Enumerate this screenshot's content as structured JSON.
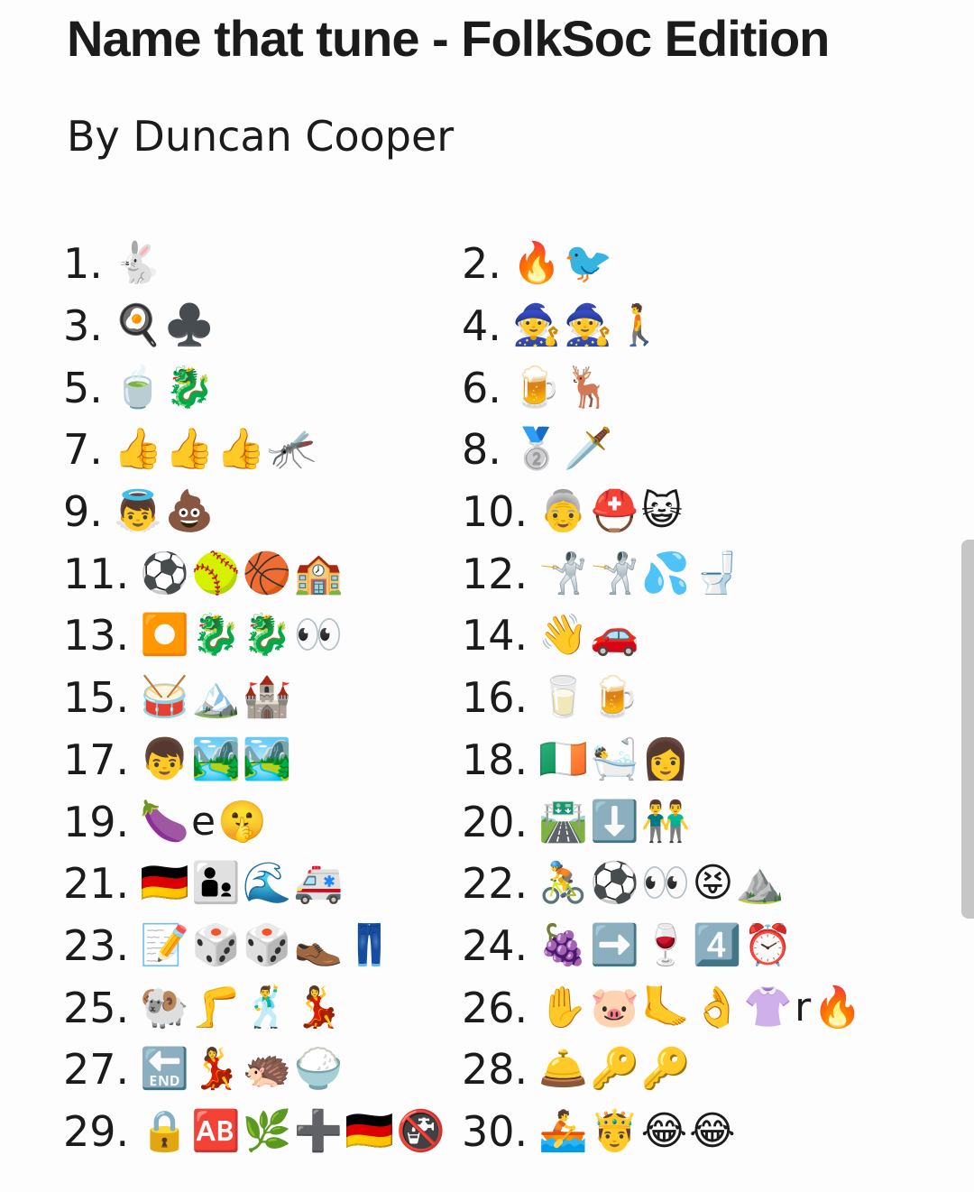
{
  "title": "Name that tune - FolkSoc Edition",
  "author": "By Duncan Cooper",
  "items": [
    {
      "num": "1.",
      "clue": "🐇"
    },
    {
      "num": "2.",
      "clue": "🔥🐦"
    },
    {
      "num": "3.",
      "clue": "🍳♣️"
    },
    {
      "num": "4.",
      "clue": "🧙🧙🚶"
    },
    {
      "num": "5.",
      "clue": "🍵🐉"
    },
    {
      "num": "6.",
      "clue": "🍺🦌"
    },
    {
      "num": "7.",
      "clue": "👍👍👍🦟"
    },
    {
      "num": "8.",
      "clue": "🥈🗡️"
    },
    {
      "num": "9.",
      "clue": "👼💩"
    },
    {
      "num": "10.",
      "clue": "👵⛑️😺"
    },
    {
      "num": "11.",
      "clue": "⚽🥎🏀🏫"
    },
    {
      "num": "12.",
      "clue": "🤺🤺💦🚽"
    },
    {
      "num": "13.",
      "clue": "⏺️🐉🐉👀"
    },
    {
      "num": "14.",
      "clue": "👋🚗"
    },
    {
      "num": "15.",
      "clue": "🥁🏔️🏰"
    },
    {
      "num": "16.",
      "clue": "🥛🍺"
    },
    {
      "num": "17.",
      "clue": "👦🏞️🏞️"
    },
    {
      "num": "18.",
      "clue": "🇮🇪🛀👩"
    },
    {
      "num": "19.",
      "clue": "🍆e🤫"
    },
    {
      "num": "20.",
      "clue": "🛣️⬇️👬"
    },
    {
      "num": "21.",
      "clue": "🇩🇪👨‍👦🌊🚑"
    },
    {
      "num": "22.",
      "clue": "🚴⚽👀😝⛰️"
    },
    {
      "num": "23.",
      "clue": "📝🎲🎲👞👖"
    },
    {
      "num": "24.",
      "clue": "🍇➡️🍷4️⃣⏰"
    },
    {
      "num": "25.",
      "clue": "🐏🦵🕺💃"
    },
    {
      "num": "26.",
      "clue": "✋🐷🦶👌👚r🔥"
    },
    {
      "num": "27.",
      "clue": "🔚💃🦔🍚"
    },
    {
      "num": "28.",
      "clue": "🛎️🔑🔑"
    },
    {
      "num": "29.",
      "clue": "🔒🆎🌿➕🇩🇪🚱"
    },
    {
      "num": "30.",
      "clue": "🚣🤴😂😂"
    }
  ]
}
